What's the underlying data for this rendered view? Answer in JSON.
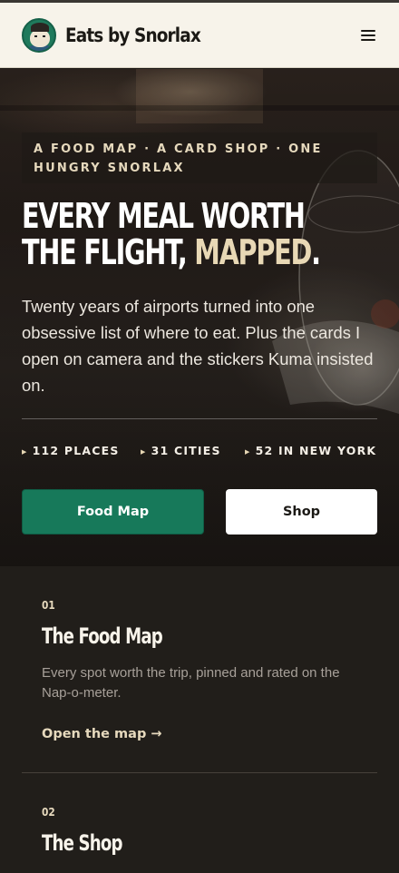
{
  "header": {
    "brand": "Eats by Snorlax"
  },
  "hero": {
    "kicker": "A FOOD MAP · A CARD SHOP · ONE HUNGRY SNORLAX",
    "headline_line1": "EVERY MEAL WORTH",
    "headline_line2_pre": "THE FLIGHT, ",
    "headline_line2_accent": "MAPPED",
    "headline_line2_post": ".",
    "intro": "Twenty years of airports turned into one obsessive list of where to eat. Plus the cards I open on camera and the stickers Kuma insisted on.",
    "stats": [
      {
        "label": "112 PLACES"
      },
      {
        "label": "31 CITIES"
      },
      {
        "label": "52 IN NEW YORK"
      }
    ],
    "buttons": {
      "food_map": "Food Map",
      "shop": "Shop"
    }
  },
  "sections": [
    {
      "number": "01",
      "title": "The Food Map",
      "description": "Every spot worth the trip, pinned and rated on the Nap-o-meter.",
      "link": "Open the map →"
    },
    {
      "number": "02",
      "title": "The Shop"
    }
  ],
  "colors": {
    "accent_green": "#17795a",
    "accent_cream": "#e8d8b5",
    "background_dark": "#211e1a",
    "header_bg": "#f7f3ea"
  }
}
